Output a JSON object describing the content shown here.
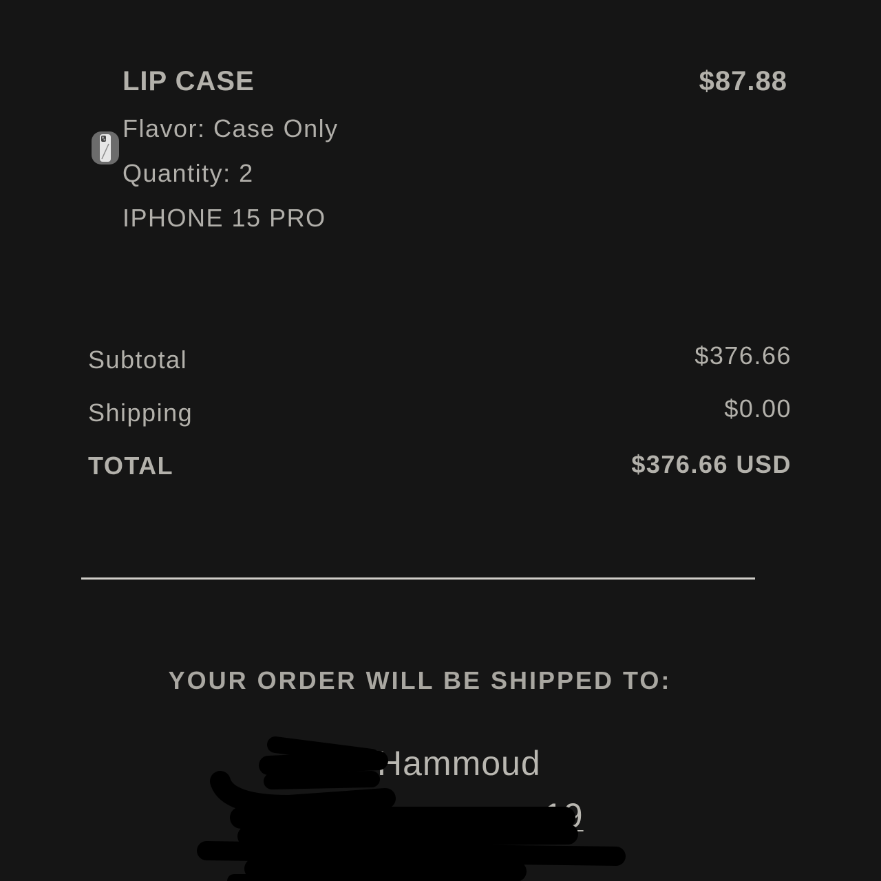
{
  "order_item": {
    "title": "LIP CASE",
    "price": "$87.88",
    "flavor": "Flavor: Case Only",
    "quantity": "Quantity: 2",
    "model": "IPHONE 15 PRO",
    "thumbnail_icon": "phone-case-icon"
  },
  "totals": {
    "subtotal_label": "Subtotal",
    "subtotal_value": "$376.66",
    "shipping_label": "Shipping",
    "shipping_value": "$0.00",
    "total_label": "TOTAL",
    "total_value": "$376.66 USD"
  },
  "shipping": {
    "heading": "YOUR ORDER WILL BE SHIPPED TO:",
    "name_visible": "Hammoud",
    "street_visible": "19"
  },
  "colors": {
    "background": "#151515",
    "text": "#b3b1ab",
    "divider": "#cfcdc8",
    "redaction": "#000000"
  }
}
